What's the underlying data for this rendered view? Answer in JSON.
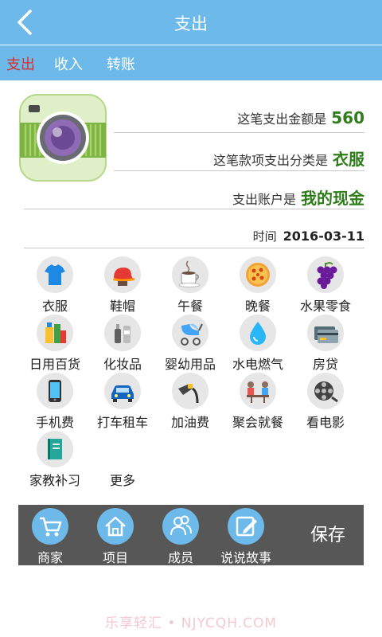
{
  "header": {
    "title": "支出"
  },
  "tabs": [
    {
      "label": "支出",
      "active": true
    },
    {
      "label": "收入",
      "active": false
    },
    {
      "label": "转账",
      "active": false
    }
  ],
  "info": {
    "amount_label": "这笔支出金额是",
    "amount_value": "560",
    "category_label": "这笔款项支出分类是",
    "category_value": "衣服",
    "account_label": "支出账户是",
    "account_value": "我的现金",
    "date_label": "时间",
    "date_value": "2016-03-11"
  },
  "categories": [
    {
      "label": "衣服",
      "icon": "tshirt-icon"
    },
    {
      "label": "鞋帽",
      "icon": "cap-icon"
    },
    {
      "label": "午餐",
      "icon": "coffee-cup-icon"
    },
    {
      "label": "晚餐",
      "icon": "pizza-icon"
    },
    {
      "label": "水果零食",
      "icon": "grapes-icon"
    },
    {
      "label": "日用百货",
      "icon": "groceries-icon"
    },
    {
      "label": "化妆品",
      "icon": "cosmetics-icon"
    },
    {
      "label": "婴幼用品",
      "icon": "stroller-icon"
    },
    {
      "label": "水电燃气",
      "icon": "water-drop-icon"
    },
    {
      "label": "房贷",
      "icon": "bank-card-icon"
    },
    {
      "label": "手机费",
      "icon": "phone-icon"
    },
    {
      "label": "打车租车",
      "icon": "car-icon"
    },
    {
      "label": "加油费",
      "icon": "fuel-nozzle-icon"
    },
    {
      "label": "聚会就餐",
      "icon": "dining-icon"
    },
    {
      "label": "看电影",
      "icon": "film-reel-icon"
    },
    {
      "label": "家教补习",
      "icon": "book-icon"
    },
    {
      "label": "更多",
      "icon": ""
    }
  ],
  "bottom_bar": {
    "items": [
      {
        "label": "商家",
        "icon": "cart-icon"
      },
      {
        "label": "项目",
        "icon": "house-icon"
      },
      {
        "label": "成员",
        "icon": "people-icon"
      },
      {
        "label": "说说故事",
        "icon": "edit-icon"
      }
    ],
    "save_label": "保存"
  },
  "watermark": "乐享轻汇 • NJYCQH.COM",
  "colors": {
    "accent": "#6cb9ea",
    "active_tab": "#d9302a",
    "value_green": "#2e7d1a",
    "bottom_bar": "#575757"
  }
}
